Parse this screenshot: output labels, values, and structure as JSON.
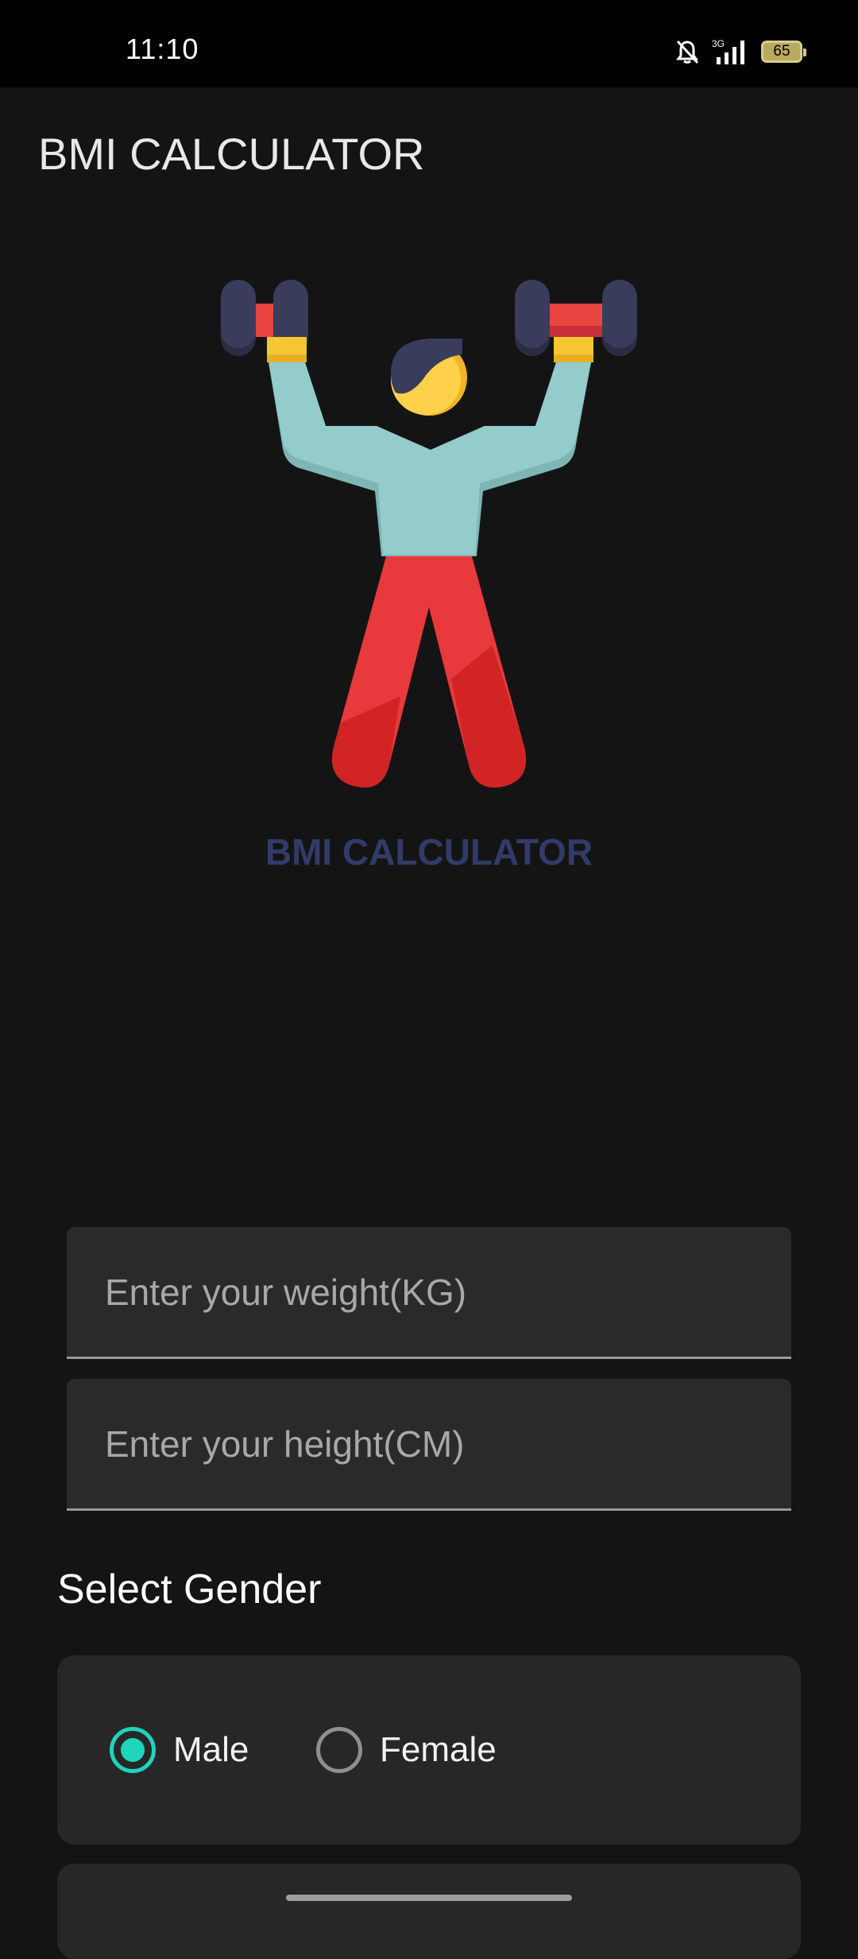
{
  "status_bar": {
    "time": "11:10",
    "network": "3G",
    "battery": "65",
    "icons": [
      "bell-off-icon",
      "signal-icon",
      "battery-icon"
    ]
  },
  "app": {
    "title": "BMI CALCULATOR"
  },
  "hero": {
    "label": "BMI CALCULATOR",
    "illustration": "weightlifter-icon"
  },
  "form": {
    "weight_placeholder": "Enter your weight(KG)",
    "weight_value": "",
    "height_placeholder": "Enter your height(CM)",
    "height_value": ""
  },
  "gender": {
    "title": "Select Gender",
    "options": [
      {
        "label": "Male",
        "selected": true
      },
      {
        "label": "Female",
        "selected": false
      }
    ]
  },
  "colors": {
    "background": "#141414",
    "accent": "#1ed4bc",
    "hero_label": "#323b68",
    "card": "#272727"
  }
}
